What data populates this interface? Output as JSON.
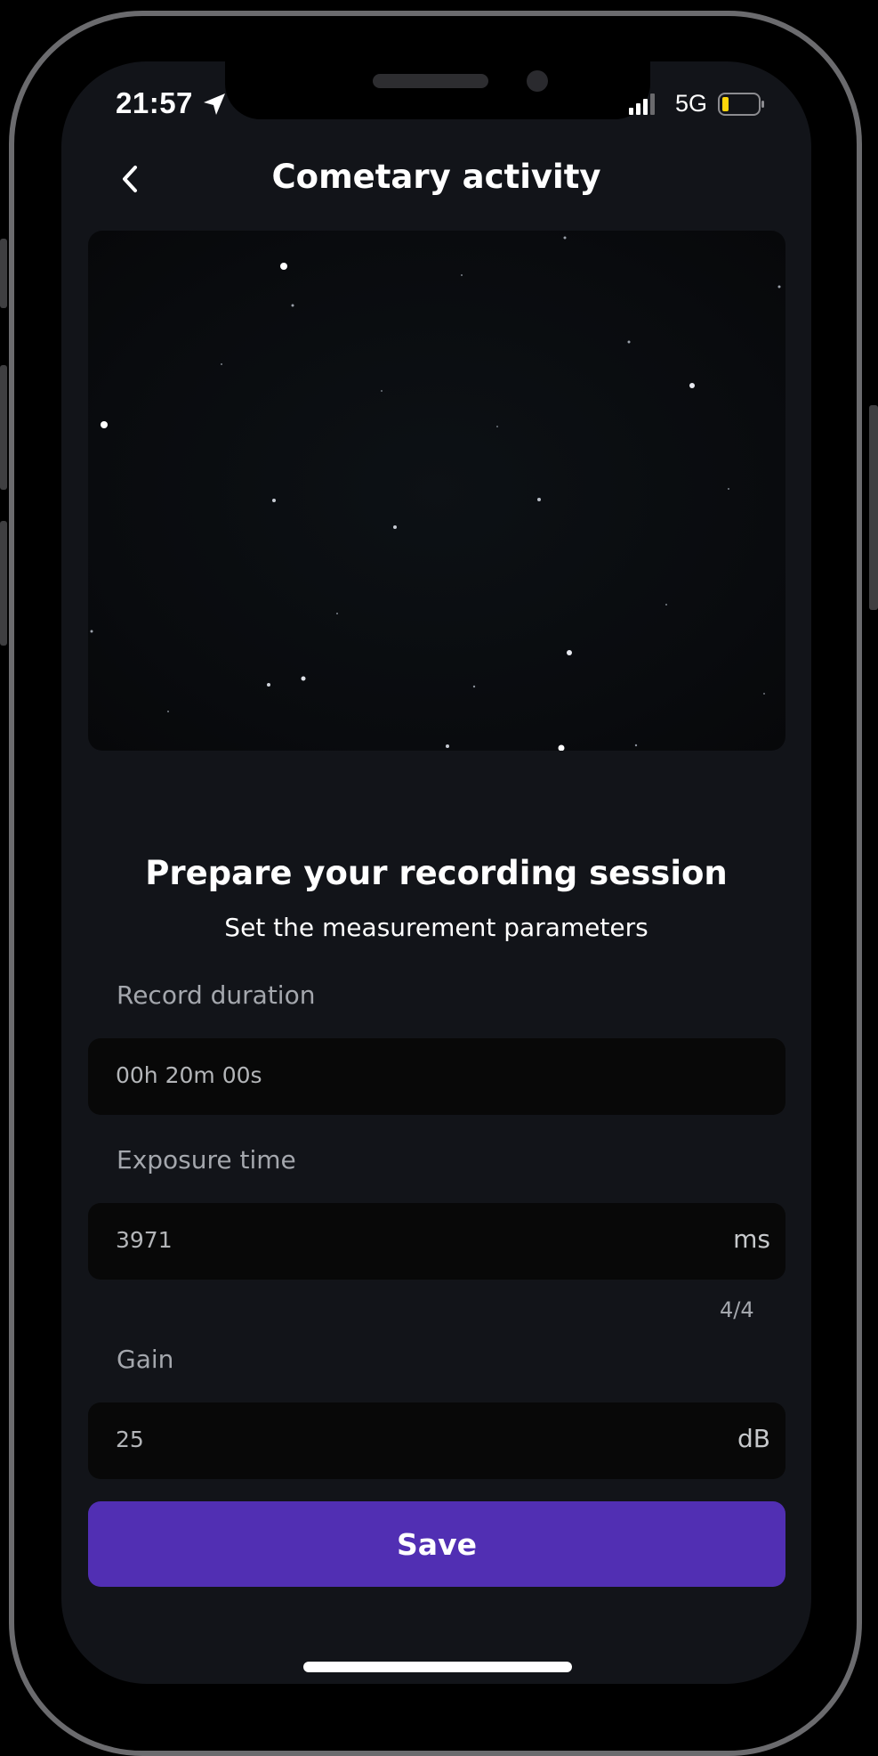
{
  "status_bar": {
    "time": "21:57",
    "network": "5G",
    "battery_color": "#ffd60a"
  },
  "header": {
    "title": "Cometary activity",
    "back_icon": "chevron-left-icon"
  },
  "session": {
    "heading": "Prepare your recording session",
    "subheading": "Set the measurement parameters"
  },
  "fields": {
    "record_duration": {
      "label": "Record duration",
      "value": "00h 20m 00s"
    },
    "exposure_time": {
      "label": "Exposure time",
      "value": "3971",
      "unit": "ms",
      "counter": "4/4"
    },
    "gain": {
      "label": "Gain",
      "value": "25",
      "unit": "dB"
    }
  },
  "actions": {
    "save_label": "Save",
    "save_color": "#512fb3"
  }
}
